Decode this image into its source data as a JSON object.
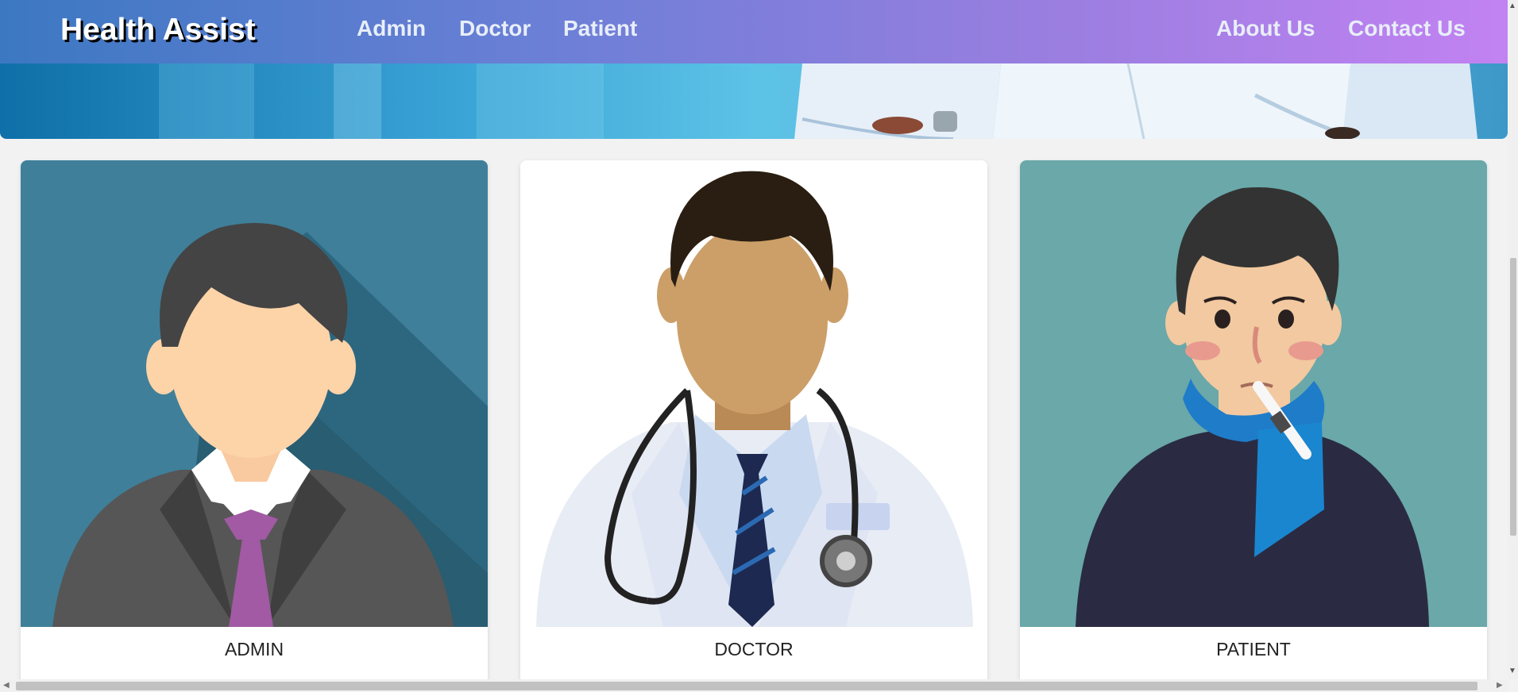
{
  "navbar": {
    "brand": "Health Assist",
    "links": [
      "Admin",
      "Doctor",
      "Patient"
    ],
    "right_links": [
      "About Us",
      "Contact Us"
    ]
  },
  "cards": [
    {
      "title": "ADMIN"
    },
    {
      "title": "DOCTOR"
    },
    {
      "title": "PATIENT"
    }
  ],
  "colors": {
    "navbar_start": "#3c78c2",
    "navbar_end": "#c282f2",
    "admin_bg": "#3f7f9a",
    "patient_bg": "#6aa8a9"
  }
}
